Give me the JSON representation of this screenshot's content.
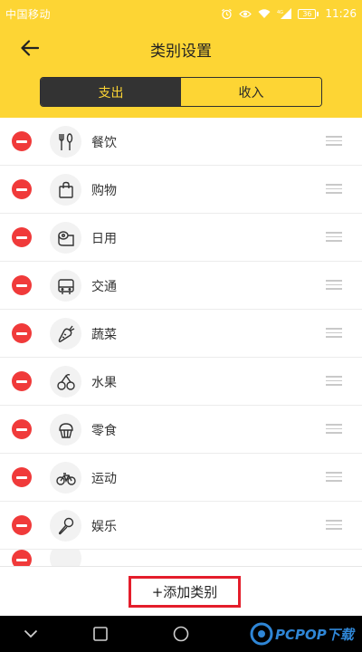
{
  "status_bar": {
    "carrier": "中国移动",
    "battery": "36",
    "time": "11:26"
  },
  "header": {
    "title": "类别设置"
  },
  "tabs": [
    {
      "label": "支出",
      "active": true
    },
    {
      "label": "收入",
      "active": false
    }
  ],
  "categories": [
    {
      "label": "餐饮",
      "icon": "utensils-icon"
    },
    {
      "label": "购物",
      "icon": "shopping-bag-icon"
    },
    {
      "label": "日用",
      "icon": "toilet-paper-icon"
    },
    {
      "label": "交通",
      "icon": "bus-icon"
    },
    {
      "label": "蔬菜",
      "icon": "carrot-icon"
    },
    {
      "label": "水果",
      "icon": "cherries-icon"
    },
    {
      "label": "零食",
      "icon": "cupcake-icon"
    },
    {
      "label": "运动",
      "icon": "bicycle-icon"
    },
    {
      "label": "娱乐",
      "icon": "microphone-icon"
    }
  ],
  "add_button": {
    "label": "+添加类别"
  },
  "watermark": {
    "text": "PCPOP下载"
  },
  "colors": {
    "accent": "#fdd534",
    "dark": "#333333",
    "delete": "#f03a3a",
    "highlight_border": "#e41d2b"
  }
}
